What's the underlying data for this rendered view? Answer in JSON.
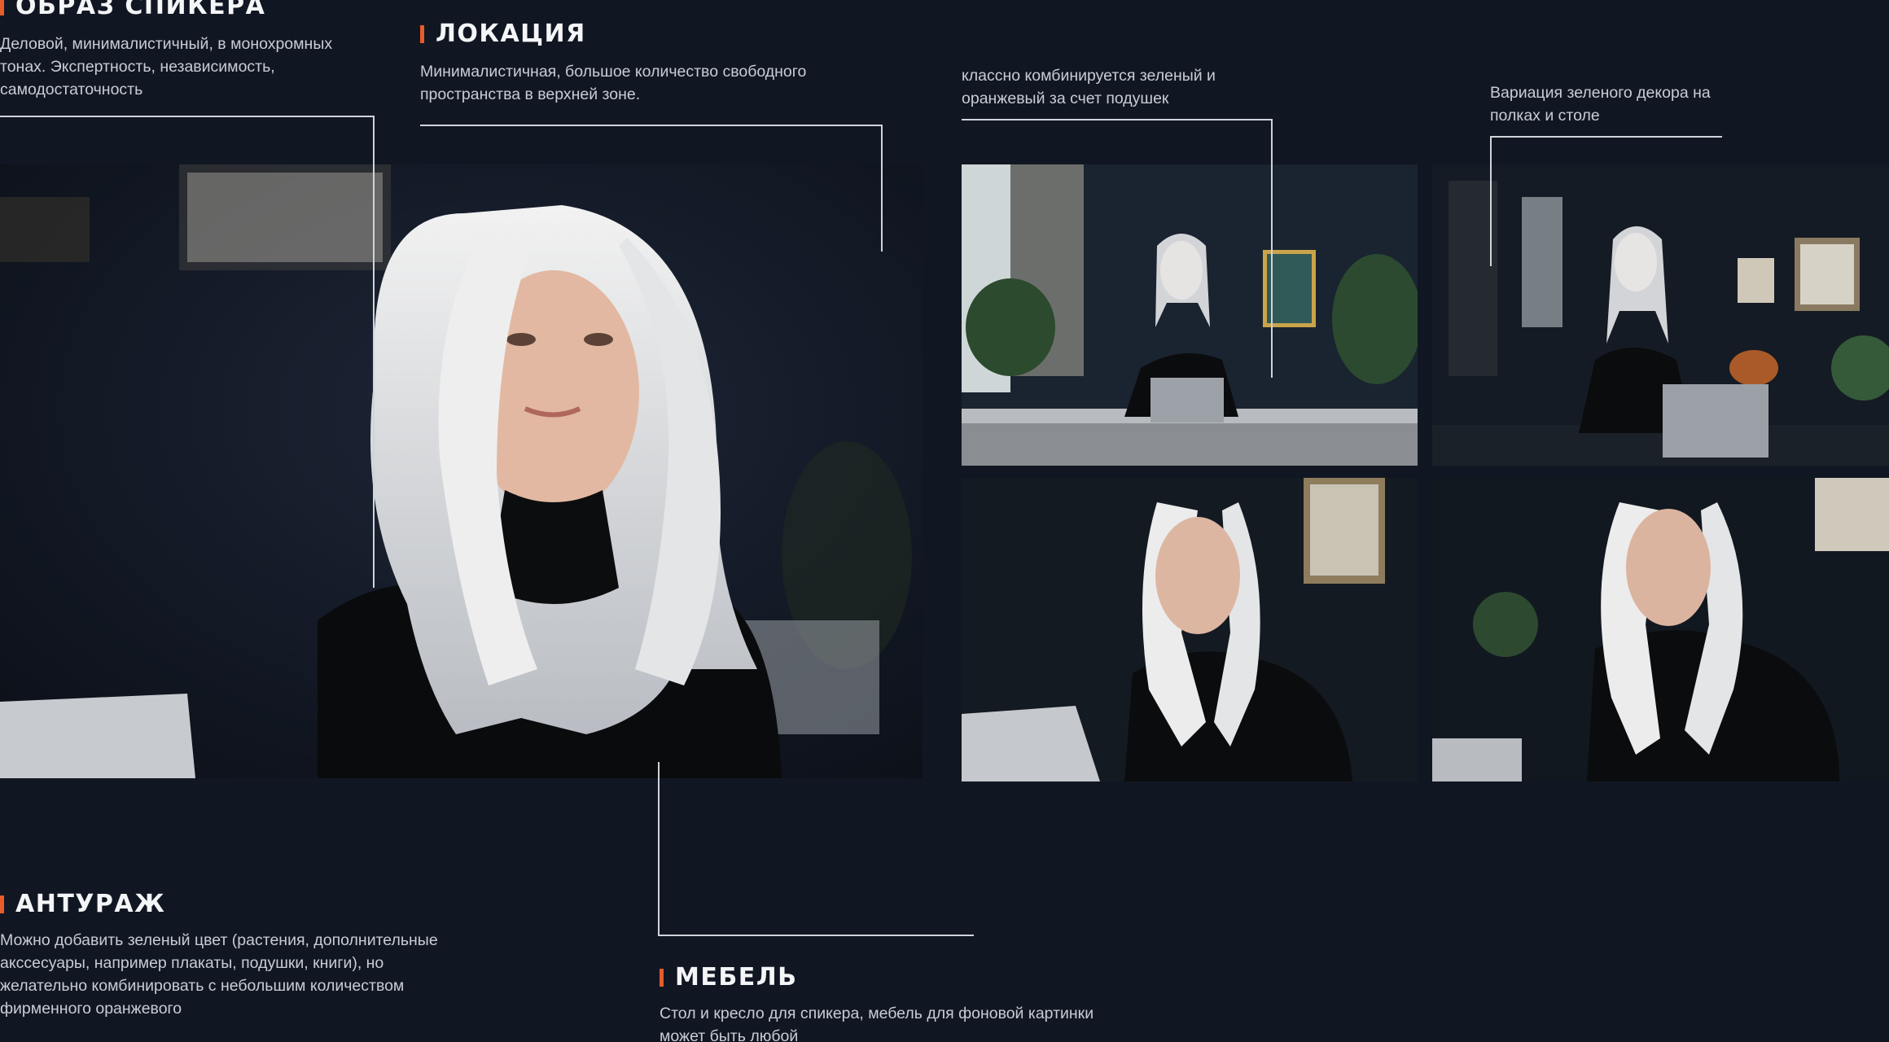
{
  "sections": {
    "speaker": {
      "title": "ОБРАЗ СПИКЕРА",
      "text": "Деловой, минималистичный, в монохромных тонах. Экспертность, независимость, самодостаточность"
    },
    "location": {
      "title": "ЛОКАЦИЯ",
      "text": "Минималистичная, большое количество свободного пространства в верхней зоне."
    },
    "combo_note": {
      "text": "классно комбинируется зеленый и оранжевый за счет подушек"
    },
    "decor_note": {
      "text": "Вариация зеленого декора на полках и столе"
    },
    "entourage": {
      "title": "АНТУРАЖ",
      "text": "Можно добавить зеленый цвет (растения, дополнительные акссесуары, например плакаты, подушки, книги), но желательно комбинировать с небольшим количеством фирменного оранжевого"
    },
    "furniture": {
      "title": "МЕБЕЛЬ",
      "text": "Стол и кресло для спикера, мебель для фоновой картинки может быть любой"
    }
  },
  "colors": {
    "background": "#111722",
    "accent": "#e85b2a",
    "heading": "#f4f5f7",
    "text": "#c8ccd4",
    "line": "#cfd3da"
  }
}
